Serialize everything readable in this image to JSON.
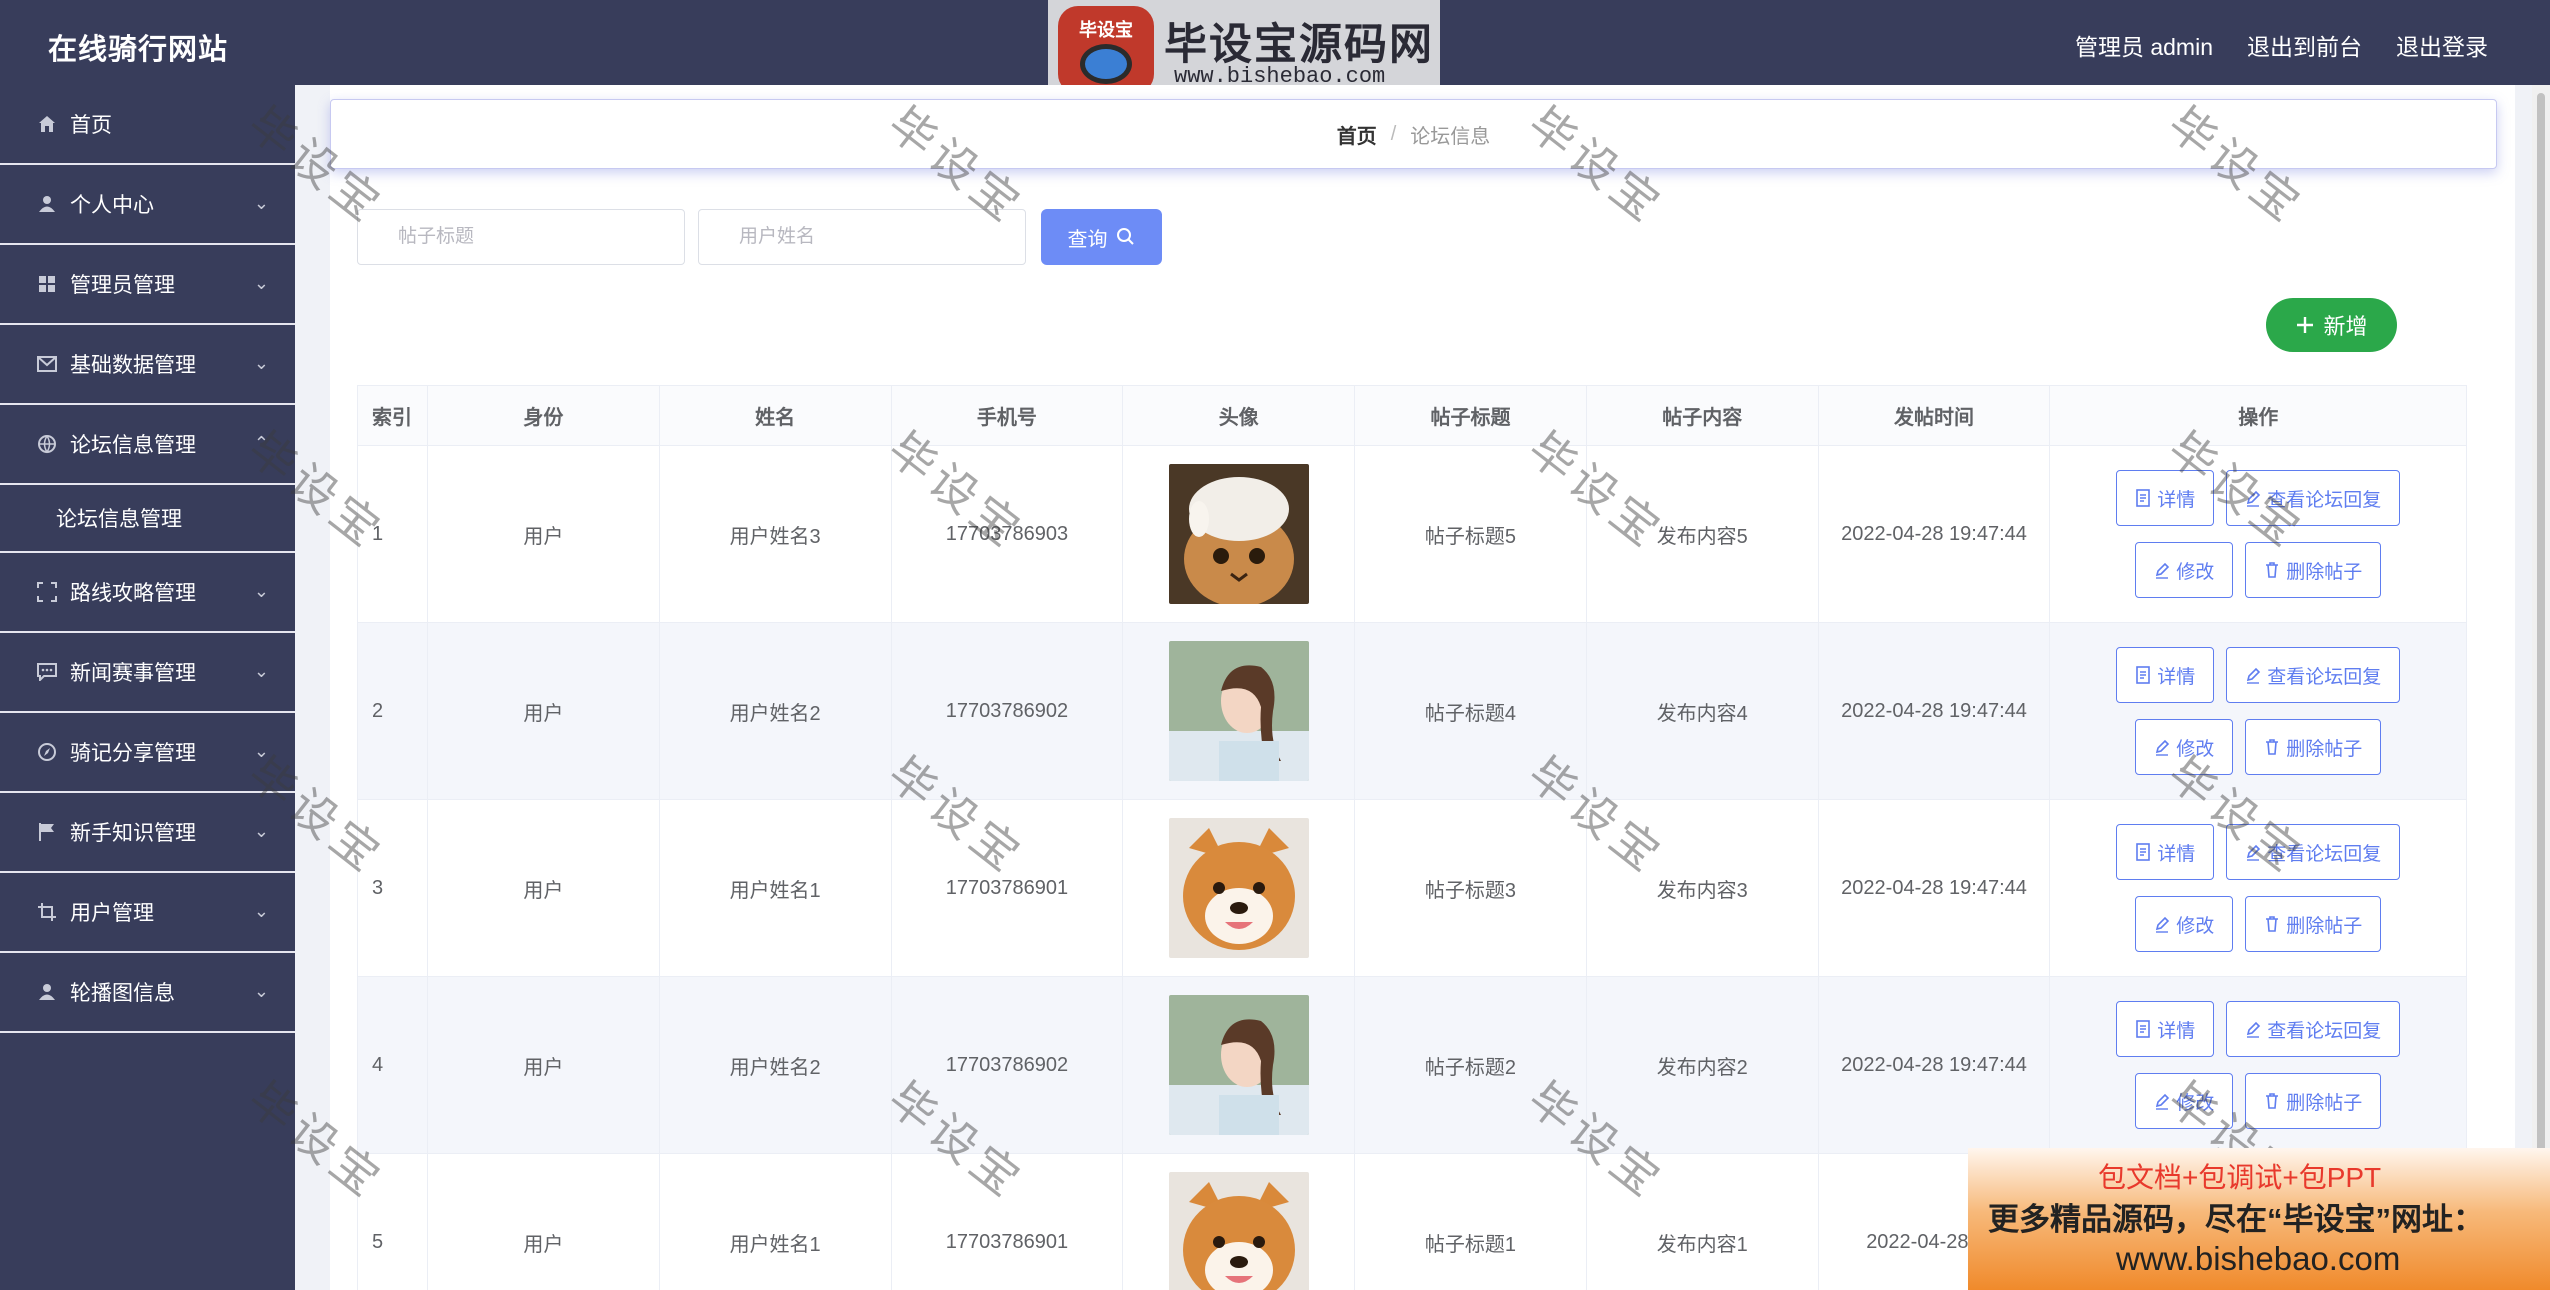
{
  "app": {
    "title": "在线骑行网站",
    "user_label": "管理员 admin",
    "to_front": "退出到前台",
    "logout": "退出登录"
  },
  "logo_watermark": {
    "badge": "毕设宝",
    "brand": "毕设宝源码网",
    "url": "www.bishebao.com"
  },
  "sidebar": {
    "items": [
      {
        "label": "首页",
        "icon": "home-icon"
      },
      {
        "label": "个人中心",
        "icon": "user-icon"
      },
      {
        "label": "管理员管理",
        "icon": "grid-icon"
      },
      {
        "label": "基础数据管理",
        "icon": "mail-icon"
      },
      {
        "label": "论坛信息管理",
        "icon": "globe-icon"
      },
      {
        "label": "论坛信息管理",
        "icon": ""
      },
      {
        "label": "路线攻略管理",
        "icon": "frame-icon"
      },
      {
        "label": "新闻赛事管理",
        "icon": "chat-icon"
      },
      {
        "label": "骑记分享管理",
        "icon": "compass-icon"
      },
      {
        "label": "新手知识管理",
        "icon": "flag-icon"
      },
      {
        "label": "用户管理",
        "icon": "crop-icon"
      },
      {
        "label": "轮播图信息",
        "icon": "user-icon"
      }
    ]
  },
  "breadcrumb": {
    "home": "首页",
    "sep": "/",
    "current": "论坛信息"
  },
  "search": {
    "title_placeholder": "帖子标题",
    "name_placeholder": "用户姓名",
    "query_label": "查询"
  },
  "add_label": "新增",
  "table": {
    "headers": [
      "索引",
      "身份",
      "姓名",
      "手机号",
      "头像",
      "帖子标题",
      "帖子内容",
      "发帖时间",
      "操作"
    ],
    "rows": [
      {
        "idx": "1",
        "role": "用户",
        "name": "用户姓名3",
        "phone": "17703786903",
        "avatar": "cat",
        "title": "帖子标题5",
        "content": "发布内容5",
        "time": "2022-04-28 19:47:44"
      },
      {
        "idx": "2",
        "role": "用户",
        "name": "用户姓名2",
        "phone": "17703786902",
        "avatar": "girl",
        "title": "帖子标题4",
        "content": "发布内容4",
        "time": "2022-04-28 19:47:44"
      },
      {
        "idx": "3",
        "role": "用户",
        "name": "用户姓名1",
        "phone": "17703786901",
        "avatar": "dog",
        "title": "帖子标题3",
        "content": "发布内容3",
        "time": "2022-04-28 19:47:44"
      },
      {
        "idx": "4",
        "role": "用户",
        "name": "用户姓名2",
        "phone": "17703786902",
        "avatar": "girl",
        "title": "帖子标题2",
        "content": "发布内容2",
        "time": "2022-04-28 19:47:44"
      },
      {
        "idx": "5",
        "role": "用户",
        "name": "用户姓名1",
        "phone": "17703786901",
        "avatar": "dog",
        "title": "帖子标题1",
        "content": "发布内容1",
        "time": "2022-04-28 19:"
      }
    ],
    "actions": {
      "detail": "详情",
      "view_reply": "查看论坛回复",
      "edit": "修改",
      "delete": "删除帖子"
    }
  },
  "watermark_text": "毕设宝",
  "ad": {
    "line1": "包文档+包调试+包PPT",
    "line2": "更多精品源码，尽在“毕设宝”网址：",
    "line3": "www.bishebao.com"
  },
  "colors": {
    "sidebar_bg": "#383d5b",
    "query_btn": "#6d8cf6",
    "add_btn": "#2ba84a",
    "action_border": "#5f7df0"
  }
}
